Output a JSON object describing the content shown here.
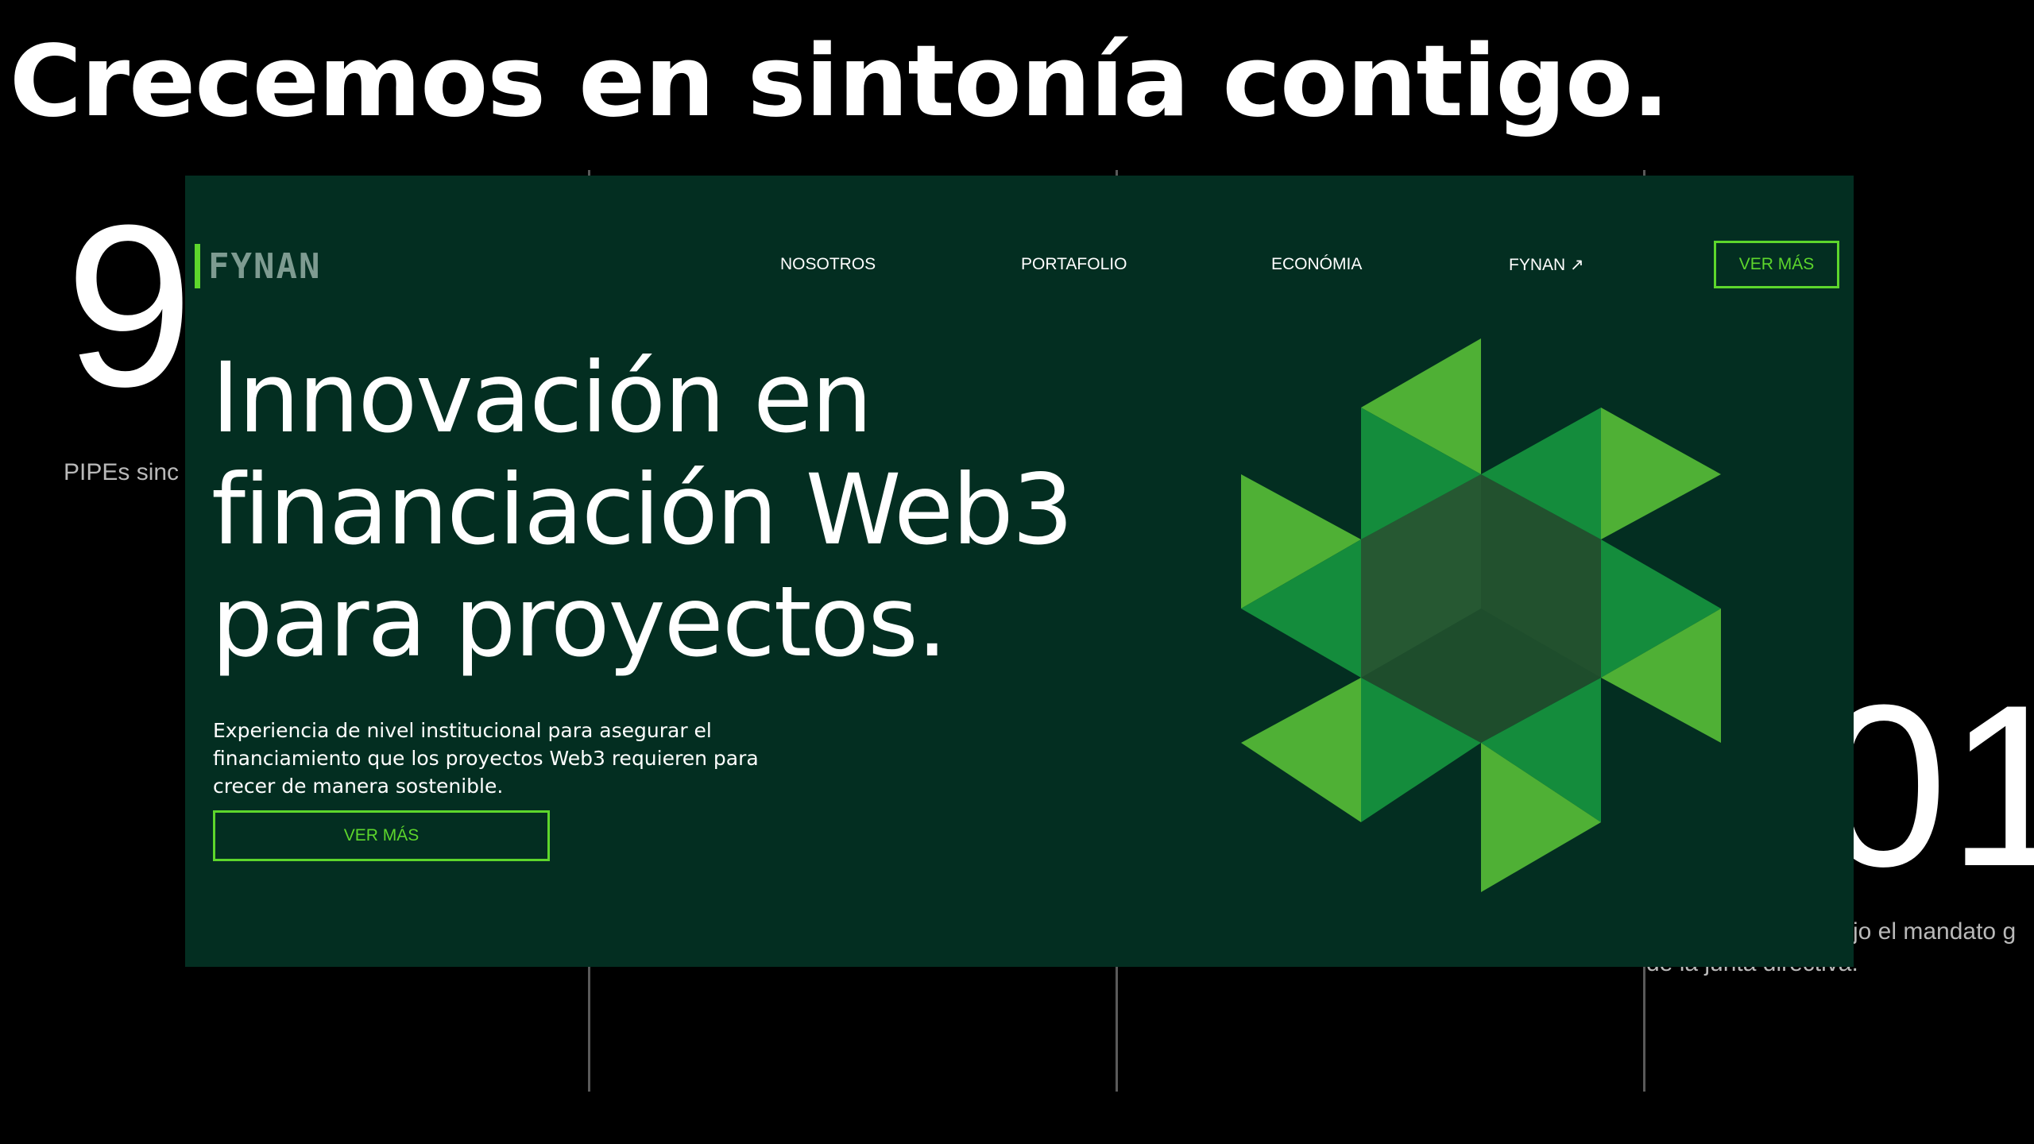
{
  "page": {
    "heading": "Crecemos en sintonía contigo."
  },
  "background": {
    "stat_left_number": "9",
    "stat_left_caption": "PIPEs sinc",
    "stat_right_number": "01",
    "stat_right_caption_line1": "jo el mandato g",
    "stat_right_caption_line2": "de la junta directiva."
  },
  "hero": {
    "logo_text": "FYNAN",
    "nav": [
      {
        "label": "NOSOTROS"
      },
      {
        "label": "PORTAFOLIO"
      },
      {
        "label": "ECONÓMIA"
      },
      {
        "label": "FYNAN ↗"
      }
    ],
    "nav_cta_label": "VER MÁS",
    "title_lines": [
      "Innovación en",
      "financiación Web3",
      "para proyectos."
    ],
    "subtitle": "Experiencia de nivel institucional para asegurar el financiamiento que los proyectos Web3 requieren para crecer de manera sostenible.",
    "cta_label": "VER MÁS",
    "graphic_icon": "geometric-triangle-star-icon"
  },
  "colors": {
    "page_background": "#000000",
    "card_background": "#032e21",
    "accent_green": "#5dd62c",
    "triangle_light": "#4fb035",
    "triangle_mid": "#148c3c",
    "triangle_dark": "#0f6b30",
    "hex_core": "#1e4d2c"
  }
}
